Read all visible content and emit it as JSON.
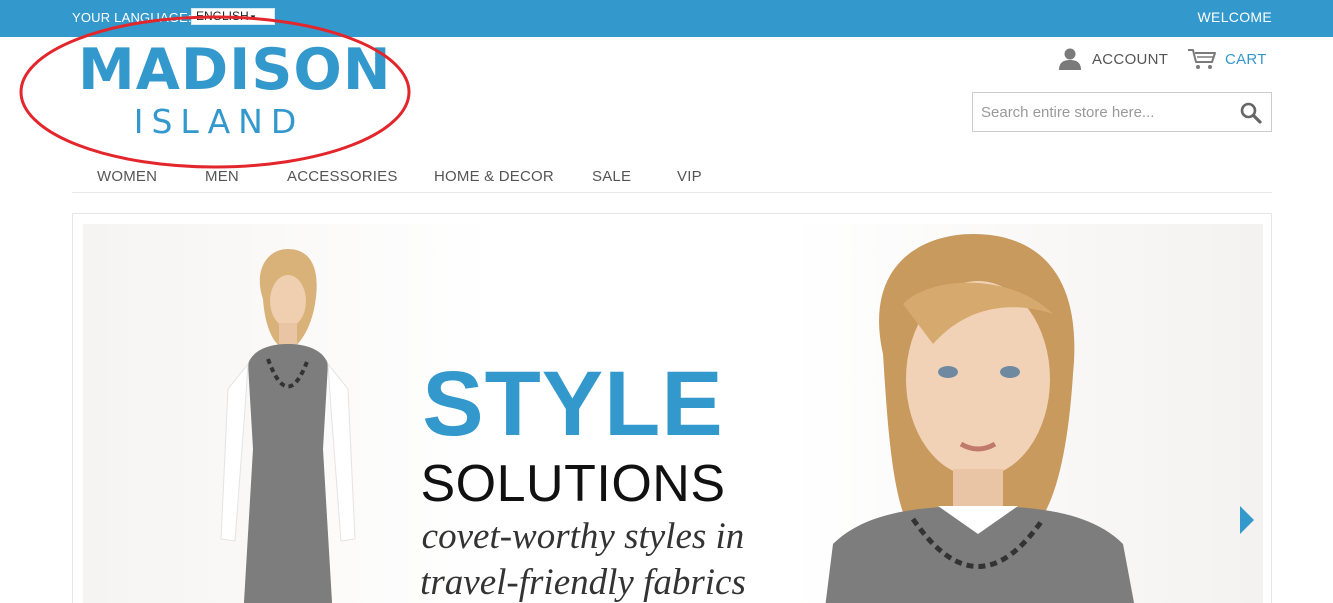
{
  "topbar": {
    "language_label": "YOUR LANGUAGE:",
    "language_value": "ENGLISH",
    "welcome": "WELCOME"
  },
  "logo": {
    "line1": "MADISON",
    "line2": "ISLAND"
  },
  "header": {
    "account_label": "ACCOUNT",
    "cart_label": "CART"
  },
  "search": {
    "placeholder": "Search entire store here..."
  },
  "nav": {
    "items": [
      {
        "label": "WOMEN"
      },
      {
        "label": "MEN"
      },
      {
        "label": "ACCESSORIES"
      },
      {
        "label": "HOME & DECOR"
      },
      {
        "label": "SALE"
      },
      {
        "label": "VIP"
      }
    ]
  },
  "hero": {
    "headline_1": "STYLE",
    "headline_2": "SOLUTIONS",
    "tagline_1": "covet-worthy styles in",
    "tagline_2": "travel-friendly fabrics"
  },
  "colors": {
    "brand_blue": "#3399cc",
    "annotation_red": "#e3262b"
  },
  "icons": [
    "user-icon",
    "cart-icon",
    "search-icon",
    "chevron-right-icon"
  ]
}
